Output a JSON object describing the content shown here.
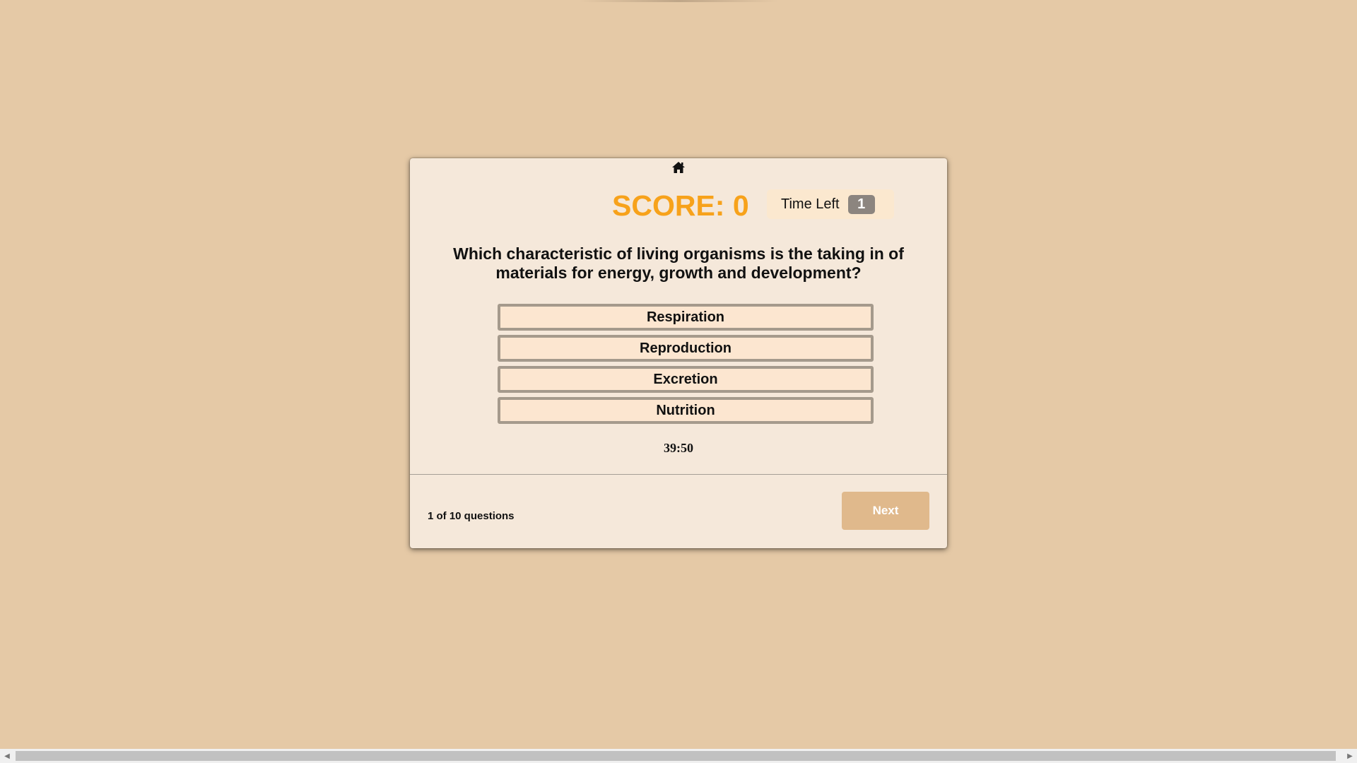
{
  "quiz": {
    "score_label": "SCORE: 0",
    "time_left_label": "Time Left",
    "time_left_value": "1",
    "question": "Which characteristic of living organisms is the taking in of materials for energy, growth and development?",
    "answers": [
      {
        "label": "Respiration"
      },
      {
        "label": "Reproduction"
      },
      {
        "label": "Excretion"
      },
      {
        "label": "Nutrition"
      }
    ],
    "timer": "39:50",
    "progress": "1 of 10 questions",
    "next_label": "Next"
  },
  "icons": {
    "home": "home-icon",
    "scroll_left": "chevron-left-icon",
    "scroll_right": "chevron-right-icon"
  },
  "colors": {
    "background": "#e5c9a6",
    "card": "#f5e8da",
    "score": "#f7a21b",
    "next_button": "#e0b98c",
    "answer_bg": "#fce6d0",
    "answer_border": "#a59a8c"
  }
}
